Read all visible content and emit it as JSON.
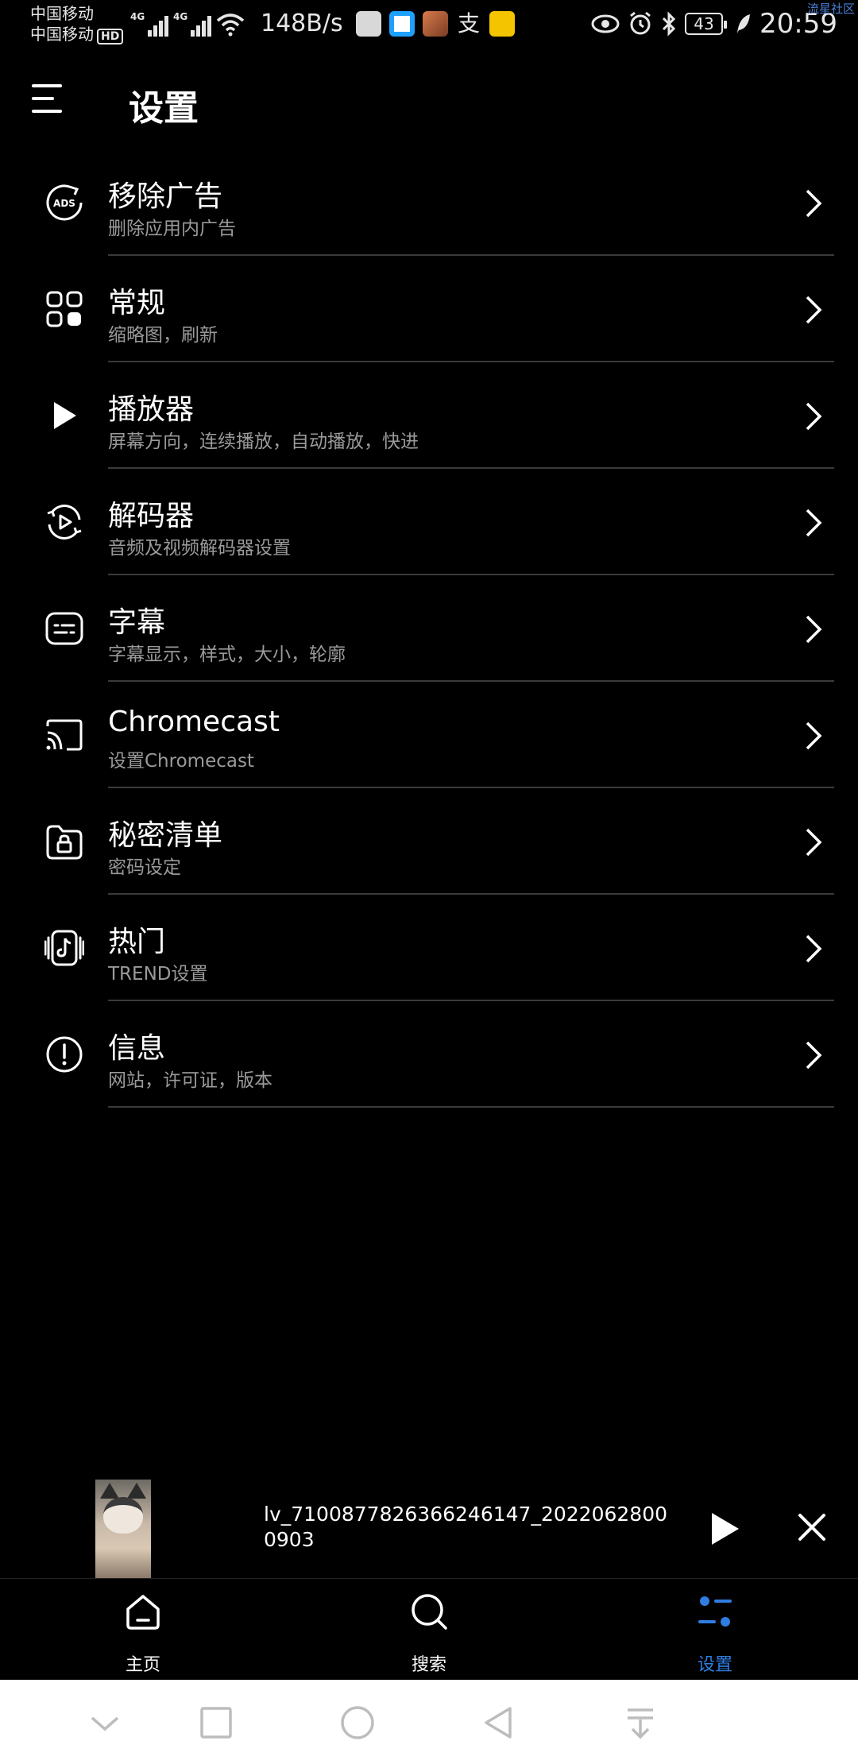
{
  "status_bar": {
    "carrier1": "中国移动",
    "carrier2": "中国移动",
    "hd": "HD",
    "net1": "4G",
    "net2": "4G",
    "net_speed": "148B/s",
    "battery": "43",
    "time": "20:59",
    "watermark": "流星社区"
  },
  "header": {
    "title": "设置"
  },
  "settings": [
    {
      "title": "移除广告",
      "subtitle": "删除应用内广告",
      "icon": "ads-icon"
    },
    {
      "title": "常规",
      "subtitle": "缩略图，刷新",
      "icon": "grid-icon"
    },
    {
      "title": "播放器",
      "subtitle": "屏幕方向，连续播放，自动播放，快进",
      "icon": "play-icon"
    },
    {
      "title": "解码器",
      "subtitle": "音频及视频解码器设置",
      "icon": "decoder-icon"
    },
    {
      "title": "字幕",
      "subtitle": "字幕显示，样式，大小，轮廓",
      "icon": "subtitle-icon"
    },
    {
      "title": "Chromecast",
      "subtitle": "设置Chromecast",
      "icon": "cast-icon"
    },
    {
      "title": "秘密清单",
      "subtitle": "密码设定",
      "icon": "lock-folder-icon"
    },
    {
      "title": "热门",
      "subtitle": "TREND设置",
      "icon": "tiktok-icon"
    },
    {
      "title": "信息",
      "subtitle": "网站，许可证，版本",
      "icon": "info-icon"
    }
  ],
  "mini_player": {
    "title": "lv_7100877826366246147_20220628000903"
  },
  "bottom_nav": [
    {
      "label": "主页",
      "icon": "home-icon",
      "active": false
    },
    {
      "label": "搜索",
      "icon": "search-icon",
      "active": false
    },
    {
      "label": "设置",
      "icon": "settings-icon",
      "active": true
    }
  ],
  "colors": {
    "accent": "#2f7de1",
    "background": "#000000",
    "subtitle": "#9a9a9a",
    "divider": "#3a3a3a"
  }
}
